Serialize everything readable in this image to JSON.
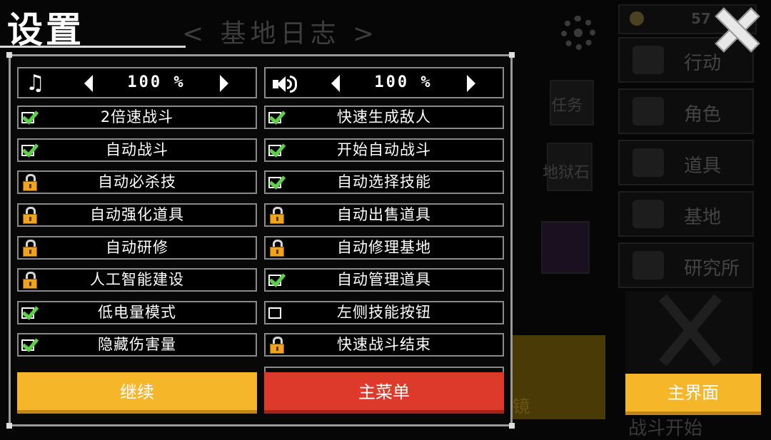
{
  "background": {
    "header_title": "< 基地日志 >",
    "currency_amount": "57",
    "side_menu": [
      "行动",
      "角色",
      "道具",
      "基地",
      "研究所"
    ],
    "middle_labels": [
      "任务",
      "地狱石"
    ],
    "yellow_label": "镜",
    "bottom_text": "战斗开始"
  },
  "settings": {
    "title": "设置",
    "music_volume": "100 %",
    "sound_volume": "100 %",
    "left_options": [
      {
        "label": "2倍速战斗",
        "state": "checked"
      },
      {
        "label": "自动战斗",
        "state": "checked"
      },
      {
        "label": "自动必杀技",
        "state": "locked"
      },
      {
        "label": "自动强化道具",
        "state": "locked"
      },
      {
        "label": "自动研修",
        "state": "locked"
      },
      {
        "label": "人工智能建设",
        "state": "locked"
      },
      {
        "label": "低电量模式",
        "state": "checked"
      },
      {
        "label": "隐藏伤害量",
        "state": "checked"
      }
    ],
    "right_options": [
      {
        "label": "快速生成敌人",
        "state": "checked"
      },
      {
        "label": "开始自动战斗",
        "state": "checked"
      },
      {
        "label": "自动选择技能",
        "state": "checked"
      },
      {
        "label": "自动出售道具",
        "state": "locked"
      },
      {
        "label": "自动修理基地",
        "state": "locked"
      },
      {
        "label": "自动管理道具",
        "state": "checked"
      },
      {
        "label": "左侧技能按钮",
        "state": "unchecked"
      },
      {
        "label": "快速战斗结束",
        "state": "locked"
      }
    ],
    "buttons": {
      "continue": "继续",
      "main_menu": "主菜单"
    }
  },
  "main_interface_button": "主界面",
  "colors": {
    "check": "#5fd04a",
    "lock": "#f0a31e",
    "continue": "#f6b62a",
    "main_menu": "#de3a2b"
  }
}
